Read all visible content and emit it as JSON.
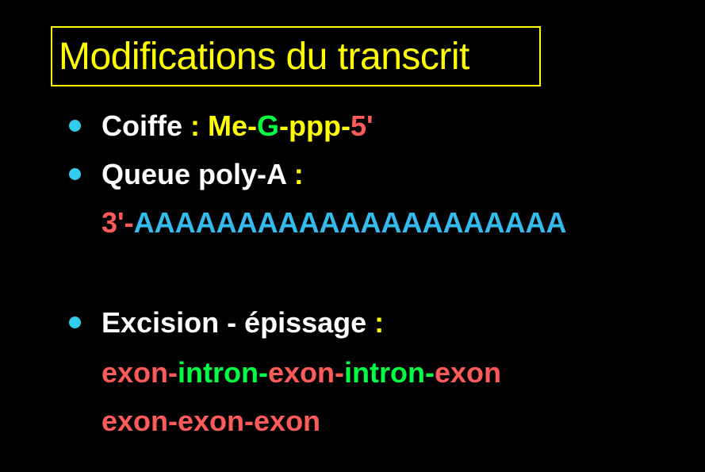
{
  "colors": {
    "background": "#000000",
    "title": "#ffff00",
    "bullet": "#33ccee",
    "white": "#ffffff",
    "yellow": "#ffff00",
    "green": "#00ff44",
    "red": "#ff5a5a",
    "blue": "#33bbee"
  },
  "title": "Modifications du transcrit",
  "items": [
    {
      "label": "Coiffe",
      "sep": " : ",
      "parts": [
        "Me-",
        "G",
        "-ppp-",
        "5'"
      ]
    },
    {
      "label": "Queue poly-A",
      "sep": " :",
      "line2": [
        "3'-",
        "AAAAAAAAAAAAAAAAAAAAA"
      ]
    },
    {
      "label": "Excision - épissage",
      "sep": " :",
      "line2": [
        "exon-",
        "intron-",
        "exon-",
        "intron-",
        "exon"
      ],
      "line3": "exon-exon-exon"
    }
  ]
}
